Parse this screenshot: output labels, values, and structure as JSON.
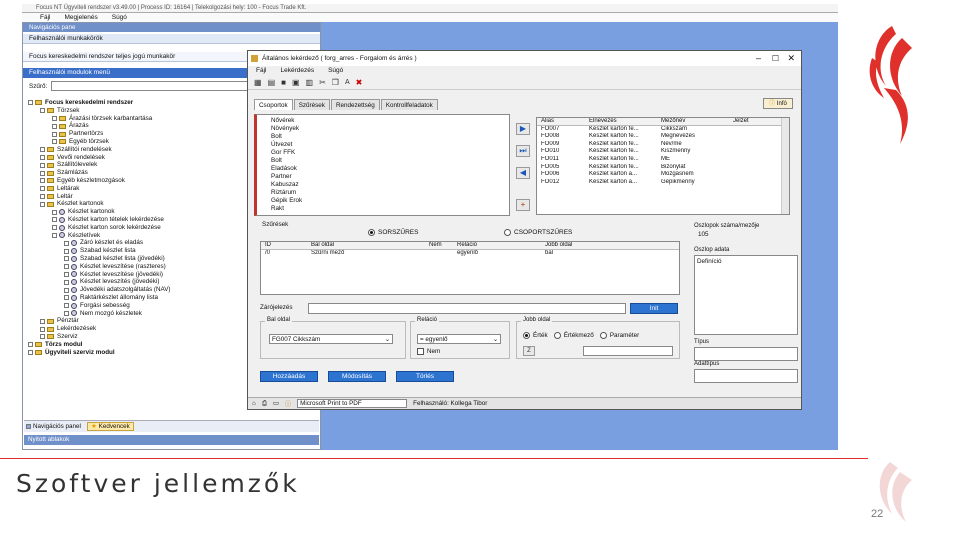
{
  "app": {
    "window_title": "Focus NT Ügyviteli rendszer v3.49.00 | Process ID: 16164 | Telekolgozási hely: 100 - Focus Trade Kft.",
    "menu": [
      "Fájl",
      "Megjelenés",
      "Súgó"
    ]
  },
  "left_panel": {
    "header": "Navigációs pane",
    "favorites": "Felhasználói munkakörök",
    "workgroup": "Focus kereskedelmi rendszer teljes jogú munkakör",
    "modules_label": "Felhasználói modulok menü",
    "filter_label": "Szűrő:",
    "filter_value": "",
    "tree": [
      {
        "label": "Focus kereskedelmi rendszer",
        "level": 0,
        "bold": true,
        "icon": "folder"
      },
      {
        "label": "Törzsek",
        "level": 1,
        "icon": "folder"
      },
      {
        "label": "Árazási törzsek karbantartása",
        "level": 2,
        "icon": "folder"
      },
      {
        "label": "Árazás",
        "level": 2,
        "icon": "folder"
      },
      {
        "label": "Partnertörzs",
        "level": 2,
        "icon": "folder"
      },
      {
        "label": "Egyéb törzsek",
        "level": 2,
        "icon": "folder"
      },
      {
        "label": "Szállítói rendelések",
        "level": 1,
        "icon": "folder"
      },
      {
        "label": "Vevői rendelések",
        "level": 1,
        "icon": "folder"
      },
      {
        "label": "Szállítólevelek",
        "level": 1,
        "icon": "folder"
      },
      {
        "label": "Számlázás",
        "level": 1,
        "icon": "folder"
      },
      {
        "label": "Egyéb készletmozgások",
        "level": 1,
        "icon": "folder"
      },
      {
        "label": "Leltárak",
        "level": 1,
        "icon": "folder"
      },
      {
        "label": "Leltár",
        "level": 1,
        "icon": "folder"
      },
      {
        "label": "Készlet kartonok",
        "level": 1,
        "icon": "folder"
      },
      {
        "label": "Készlet kartonok",
        "level": 2,
        "icon": "gear"
      },
      {
        "label": "Készlet karton tételek lekérdezése",
        "level": 2,
        "icon": "gear"
      },
      {
        "label": "Készlet karton sorok lekérdezése",
        "level": 2,
        "icon": "gear"
      },
      {
        "label": "Készletívek",
        "level": 2,
        "icon": "gear"
      },
      {
        "label": "Záró készlet és eladás",
        "level": 3,
        "icon": "gear"
      },
      {
        "label": "Szabad készlet lista",
        "level": 3,
        "icon": "gear"
      },
      {
        "label": "Szabad készlet lista (jövedéki)",
        "level": 3,
        "icon": "gear"
      },
      {
        "label": "Készlet leveszítése (raszteres)",
        "level": 3,
        "icon": "gear"
      },
      {
        "label": "Készlet leveszítése (jövedéki)",
        "level": 3,
        "icon": "gear"
      },
      {
        "label": "Készlet leveszítés (jövedéki)",
        "level": 3,
        "icon": "gear"
      },
      {
        "label": "Jövedéki adatszolgáltatás (NAV)",
        "level": 3,
        "icon": "gear"
      },
      {
        "label": "Raktárkészlet állomány lista",
        "level": 3,
        "icon": "gear"
      },
      {
        "label": "Forgási sebesség",
        "level": 3,
        "icon": "gear"
      },
      {
        "label": "Nem mozgó készletek",
        "level": 3,
        "icon": "gear"
      },
      {
        "label": "Pénztár",
        "level": 1,
        "icon": "folder"
      },
      {
        "label": "Lekérdezések",
        "level": 1,
        "icon": "folder"
      },
      {
        "label": "Szerviz",
        "level": 1,
        "icon": "folder"
      },
      {
        "label": "Törzs modul",
        "level": 0,
        "bold": true,
        "icon": "folder"
      },
      {
        "label": "Ügyviteli szerviz modul",
        "level": 0,
        "bold": true,
        "icon": "folder"
      }
    ],
    "bottom_tabs": [
      "Navigációs panel",
      "Kedvencek"
    ],
    "footer": "Nyitott ablakok"
  },
  "dialog": {
    "title": "Általános lekérdező ( forg_arres - Forgalom és árrés )",
    "menu": [
      "Fájl",
      "Lekérdezés",
      "Súgó"
    ],
    "tabs": [
      "Csoportok",
      "Szűrések",
      "Rendezettség",
      "Kontrollfeladatok"
    ],
    "info_button": "Infó",
    "groups": [
      "Nővérek",
      "Növények",
      "Bolt",
      "Útvezet",
      "Gor FFK",
      "Bolt",
      "Eladások",
      "Partner",
      "Kabuszaz",
      "Riztárum",
      "Gépik Erok",
      "Rakt"
    ],
    "table_headers": [
      "Alias",
      "Elnevezés",
      "Mezőnév",
      "Jelzet"
    ],
    "table_rows": [
      [
        "FO007",
        "Készlet karton fe...",
        "Cikkszám",
        ""
      ],
      [
        "FO008",
        "Készlet karton fe...",
        "Megnevezés",
        ""
      ],
      [
        "FO009",
        "Készlet karton fe...",
        "Név/me",
        ""
      ],
      [
        "FO010",
        "Készlet karton fe...",
        "Kiszmenny",
        ""
      ],
      [
        "FO011",
        "Készlet karton fe...",
        "ME",
        ""
      ],
      [
        "FO005",
        "Készlet karton fe...",
        "Bizonylat",
        ""
      ],
      [
        "FO006",
        "Készlet karton a...",
        "Mozgásnem",
        ""
      ],
      [
        "FO012",
        "Készlet karton a...",
        "Gépikmenny",
        ""
      ]
    ],
    "conditions_label": "Szűrések",
    "radio_order": "SORSZŰRES",
    "radio_group": "CSOPORTSZŰRES",
    "cond_headers": [
      "ID",
      "Bal oldal",
      "Nem",
      "Reláció",
      "Jobb oldal"
    ],
    "cond_row": [
      "/0",
      "Szűrni mező",
      "",
      "egyenlő",
      "bal"
    ],
    "formula_label": "Zárójelezés",
    "formula_value": "",
    "formula_button": "Init",
    "left_side_label": "Bal oldal",
    "left_side_value": "FG007 Cikkszám",
    "relation_label": "Reláció",
    "relation_value": "= egyenlő",
    "not_label": "Nem",
    "right_side_label": "Jobb oldal",
    "right_radios": [
      "Érték",
      "Értékmező",
      "Paraméter"
    ],
    "right_btn": "Z",
    "right_value": "",
    "action_buttons": [
      "Hozzáadás",
      "Módosítás",
      "Törlés"
    ],
    "query_field_label": "Oszlopok száma/mezője",
    "query_field_value": "105",
    "desc_label": "Oszlop adata",
    "desc_value": "Definíció",
    "type_label": "Típus",
    "type_value": "",
    "format_label": "Adattípus",
    "format_value": "",
    "status_printer": "Microsoft Print to PDF",
    "status_user": "Felhasználó: Kollega Tibor"
  },
  "slide": {
    "title": "Szoftver jellemzők",
    "page_number": "22"
  },
  "colors": {
    "accent_red": "#e0302b",
    "desktop_blue": "#7a9fe0",
    "button_blue": "#2d73d0"
  }
}
